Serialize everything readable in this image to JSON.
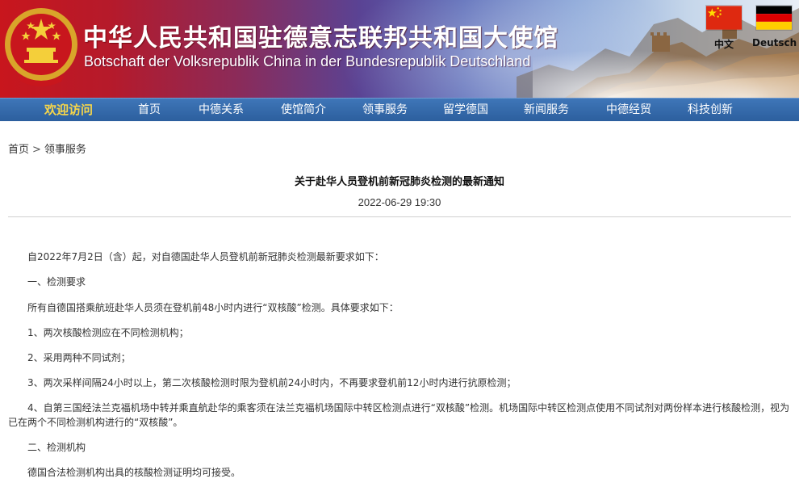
{
  "header": {
    "title_cn": "中华人民共和国驻德意志联邦共和国大使馆",
    "title_de": "Botschaft der Volksrepublik China in der Bundesrepublik Deutschland",
    "languages": [
      {
        "label": "中文",
        "flag": "cn-flag-icon"
      },
      {
        "label": "Deutsch",
        "flag": "de-flag-icon"
      }
    ],
    "colors": {
      "banner_red": "#c8161d",
      "banner_blue": "#5a6bb8",
      "nav_blue": "#2c5f9e",
      "featured_yellow": "#f7d64a"
    }
  },
  "nav": {
    "items": [
      "欢迎访问",
      "首页",
      "中德关系",
      "使馆简介",
      "领事服务",
      "留学德国",
      "新闻服务",
      "中德经贸",
      "科技创新"
    ]
  },
  "breadcrumb": {
    "home": "首页",
    "separator": ">",
    "current": "领事服务"
  },
  "article": {
    "title": "关于赴华人员登机前新冠肺炎检测的最新通知",
    "date": "2022-06-29 19:30",
    "paragraphs": [
      "自2022年7月2日（含）起，对自德国赴华人员登机前新冠肺炎检测最新要求如下：",
      "一、检测要求",
      "所有自德国搭乘航班赴华人员须在登机前48小时内进行“双核酸”检测。具体要求如下：",
      "1、两次核酸检测应在不同检测机构；",
      "2、采用两种不同试剂；",
      "3、两次采样间隔24小时以上，第二次核酸检测时限为登机前24小时内，不再要求登机前12小时内进行抗原检测；",
      "4、自第三国经法兰克福机场中转并乘直航赴华的乘客须在法兰克福机场国际中转区检测点进行“双核酸”检测。机场国际中转区检测点使用不同试剂对两份样本进行核酸检测，视为已在两个不同检测机构进行的“双核酸”。",
      "二、检测机构",
      "德国合法检测机构出具的核酸检测证明均可接受。"
    ]
  }
}
